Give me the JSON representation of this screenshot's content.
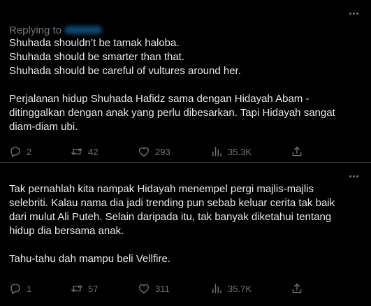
{
  "colors": {
    "background": "#000000",
    "text": "#e7e9ea",
    "muted": "#71767b",
    "divider": "#2f3336",
    "link": "#1d9bf0"
  },
  "tweets": [
    {
      "replying_label": "Replying to",
      "lines": [
        "Shuhada shouldn’t be tamak haloba.",
        "Shuhada should be smarter than that.",
        "Shuhada should be careful of vultures around her.",
        "",
        "Perjalanan hidup Shuhada Hafidz sama dengan Hidayah Abam -",
        "ditinggalkan dengan anak yang perlu dibesarkan. Tapi Hidayah sangat",
        "diam-diam ubi."
      ],
      "actions": {
        "replies": "2",
        "reposts": "42",
        "likes": "293",
        "views": "35.3K"
      },
      "icons": [
        "more-icon",
        "reply-icon",
        "retweet-icon",
        "like-icon",
        "views-icon",
        "share-icon"
      ]
    },
    {
      "lines": [
        "Tak pernahlah kita nampak Hidayah menempel pergi majlis-majlis",
        "selebriti. Kalau nama dia jadi trending pun sebab keluar cerita tak baik",
        "dari mulut Ali Puteh. Selain daripada itu, tak banyak diketahui tentang",
        "hidup dia bersama anak.",
        "",
        "Tahu-tahu dah mampu beli Vellfire."
      ],
      "actions": {
        "replies": "1",
        "reposts": "57",
        "likes": "311",
        "views": "35.7K"
      },
      "icons": [
        "more-icon",
        "reply-icon",
        "retweet-icon",
        "like-icon",
        "views-icon",
        "share-icon"
      ]
    }
  ]
}
